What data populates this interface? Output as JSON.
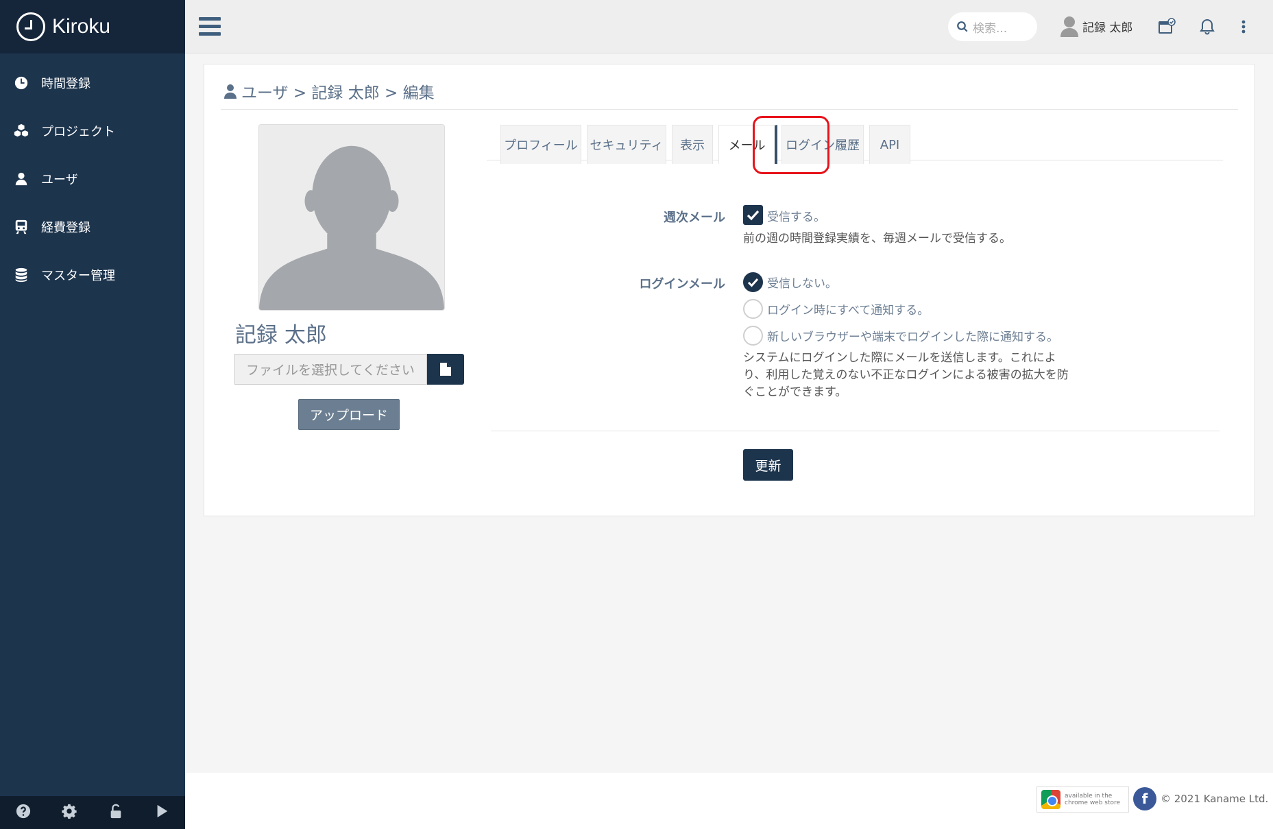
{
  "brand": {
    "name": "Kiroku"
  },
  "sidebar": {
    "items": [
      {
        "label": "時間登録",
        "icon": "clock-icon"
      },
      {
        "label": "プロジェクト",
        "icon": "cubes-icon"
      },
      {
        "label": "ユーザ",
        "icon": "user-icon"
      },
      {
        "label": "経費登録",
        "icon": "train-icon"
      },
      {
        "label": "マスター管理",
        "icon": "database-icon"
      }
    ],
    "footer_icons": [
      "help-icon",
      "gear-icon",
      "unlock-icon",
      "play-icon"
    ]
  },
  "topbar": {
    "search_placeholder": "検索...",
    "user_name": "記録 太郎",
    "icons": [
      "menu-icon",
      "search-icon",
      "user-avatar-icon",
      "calendar-check-icon",
      "bell-icon",
      "more-vertical-icon"
    ]
  },
  "breadcrumb": "ユーザ > 記録 太郎 > 編集",
  "profile": {
    "name": "記録 太郎",
    "file_placeholder": "ファイルを選択してください",
    "upload_label": "アップロード"
  },
  "tabs": [
    {
      "label": "プロフィール"
    },
    {
      "label": "セキュリティ"
    },
    {
      "label": "表示"
    },
    {
      "label": "メール"
    },
    {
      "label": "ログイン履歴"
    },
    {
      "label": "API"
    }
  ],
  "active_tab": "メール",
  "mail_form": {
    "weekly_label": "週次メール",
    "weekly_option": "受信する。",
    "weekly_checked": true,
    "weekly_help": "前の週の時間登録実績を、毎週メールで受信する。",
    "login_label": "ログインメール",
    "login_options": [
      {
        "label": "受信しない。",
        "selected": true
      },
      {
        "label": "ログイン時にすべて通知する。",
        "selected": false
      },
      {
        "label": "新しいブラウザーや端末でログインした際に通知する。",
        "selected": false
      }
    ],
    "login_help_lines": [
      "システムにログインした際にメールを送信します。これによ",
      "り、利用した覚えのない不正なログインによる被害の拡大を防",
      "ぐことができます。"
    ],
    "submit_label": "更新"
  },
  "footer": {
    "store_badge_lines": [
      "available in the",
      "chrome web store"
    ],
    "facebook_glyph": "f",
    "copyright": "© 2021 Kaname Ltd."
  },
  "colors": {
    "sidebar": "#1d344d",
    "accent": "#1d344d",
    "highlight": "#e8121a"
  }
}
